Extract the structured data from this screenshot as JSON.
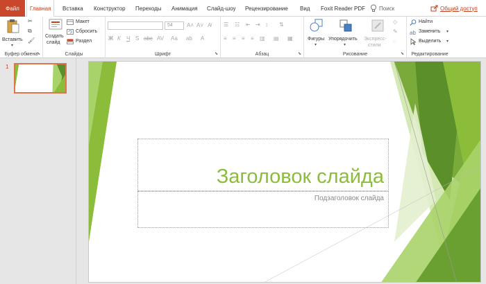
{
  "tabs": {
    "file": "Файл",
    "items": [
      "Главная",
      "Вставка",
      "Конструктор",
      "Переходы",
      "Анимация",
      "Слайд-шоу",
      "Рецензирование",
      "Вид",
      "Foxit Reader PDF"
    ],
    "search": "Поиск",
    "share": "Общий доступ"
  },
  "ribbon": {
    "clipboard": {
      "label": "Буфер обмена",
      "paste": "Вставить"
    },
    "slides": {
      "label": "Слайды",
      "new_slide_1": "Создать",
      "new_slide_2": "слайд",
      "layout": "Макет",
      "reset": "Сбросить",
      "section": "Раздел"
    },
    "font": {
      "label": "Шрифт",
      "size": "54"
    },
    "paragraph": {
      "label": "Абзац"
    },
    "drawing": {
      "label": "Рисование",
      "shapes": "Фигуры",
      "arrange": "Упорядочить",
      "styles_1": "Экспресс-",
      "styles_2": "стили"
    },
    "editing": {
      "label": "Редактирование",
      "find": "Найти",
      "replace": "Заменить",
      "select": "Выделить"
    }
  },
  "slide": {
    "number": "1",
    "title": "Заголовок слайда",
    "subtitle": "Подзаголовок слайда"
  },
  "colors": {
    "accent": "#c43e1c",
    "file_tab": "#c9472a",
    "green_light": "#a8d36a",
    "green_mid": "#8bbd3a",
    "green_dark": "#5a8f2a"
  }
}
